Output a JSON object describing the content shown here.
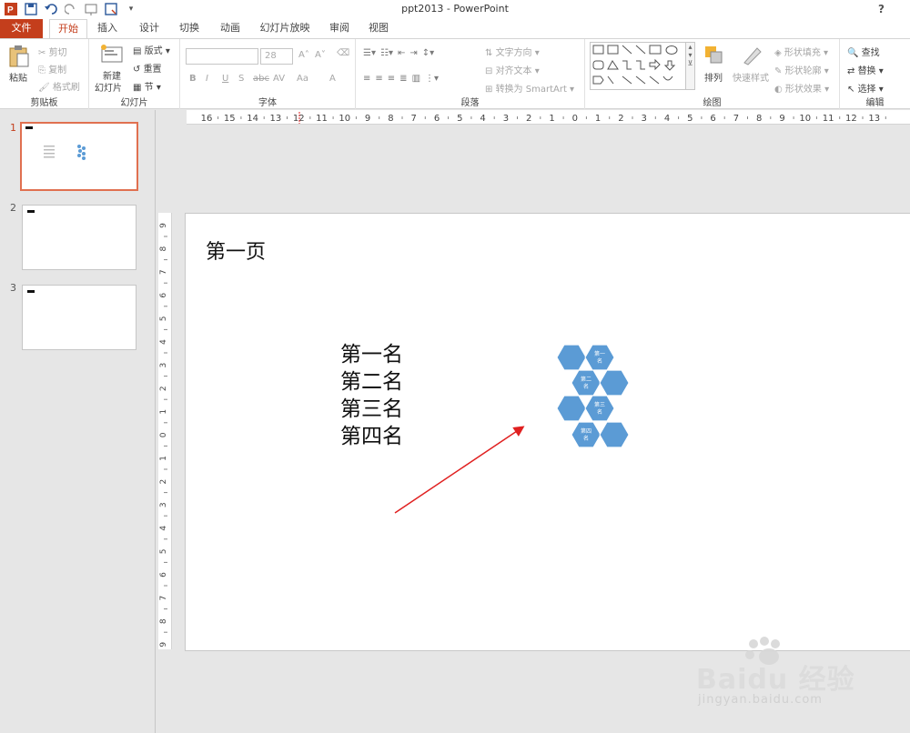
{
  "window": {
    "title": "ppt2013 - PowerPoint",
    "help": "?"
  },
  "tabs": [
    "文件",
    "开始",
    "插入",
    "设计",
    "切换",
    "动画",
    "幻灯片放映",
    "审阅",
    "视图"
  ],
  "ribbon": {
    "clipboard": {
      "label": "剪贴板",
      "paste": "粘贴",
      "cut": "剪切",
      "copy": "复制",
      "format_painter": "格式刷"
    },
    "slides": {
      "label": "幻灯片",
      "new_slide_1": "新建",
      "new_slide_2": "幻灯片",
      "layout": "版式",
      "reset": "重置",
      "section": "节"
    },
    "font": {
      "label": "字体",
      "font_name": "",
      "font_size": "28",
      "bold": "B",
      "italic": "I",
      "underline": "U",
      "shadow": "S",
      "strike": "abc",
      "spacing": "AV",
      "case": "Aa",
      "color": "A",
      "grow": "A",
      "shrink": "A"
    },
    "paragraph": {
      "label": "段落",
      "text_direction": "文字方向",
      "align_text": "对齐文本",
      "convert_smartart": "转换为 SmartArt"
    },
    "drawing": {
      "label": "绘图",
      "arrange": "排列",
      "quick_styles": "快速样式",
      "shape_fill": "形状填充",
      "shape_outline": "形状轮廓",
      "shape_effects": "形状效果"
    },
    "editing": {
      "label": "编辑",
      "find": "查找",
      "replace": "替换",
      "select": "选择"
    }
  },
  "thumbnails": [
    {
      "number": "1",
      "selected": true
    },
    {
      "number": "2",
      "selected": false
    },
    {
      "number": "3",
      "selected": false
    }
  ],
  "ruler": {
    "horizontal": [
      "16",
      "15",
      "14",
      "13",
      "12",
      "11",
      "10",
      "9",
      "8",
      "7",
      "6",
      "5",
      "4",
      "3",
      "2",
      "1",
      "0",
      "1",
      "2",
      "3",
      "4",
      "5",
      "6",
      "7",
      "8",
      "9",
      "10",
      "11",
      "12",
      "13"
    ],
    "vertical": [
      "9",
      "8",
      "7",
      "6",
      "5",
      "4",
      "3",
      "2",
      "1",
      "0",
      "1",
      "2",
      "3",
      "4",
      "5",
      "6",
      "7",
      "8",
      "9"
    ]
  },
  "slide": {
    "title": "第一页",
    "items": [
      "第一名",
      "第二名",
      "第三名",
      "第四名"
    ],
    "smartart_labels": [
      "第一名",
      "第二名",
      "第三名",
      "第四名"
    ],
    "hex_color": "#5b9bd5",
    "arrow_color": "#e02020"
  },
  "watermark": {
    "brand": "Baidu 经验",
    "url": "jingyan.baidu.com"
  },
  "colors": {
    "accent": "#c43e1c",
    "thumb_border": "#e07050"
  }
}
